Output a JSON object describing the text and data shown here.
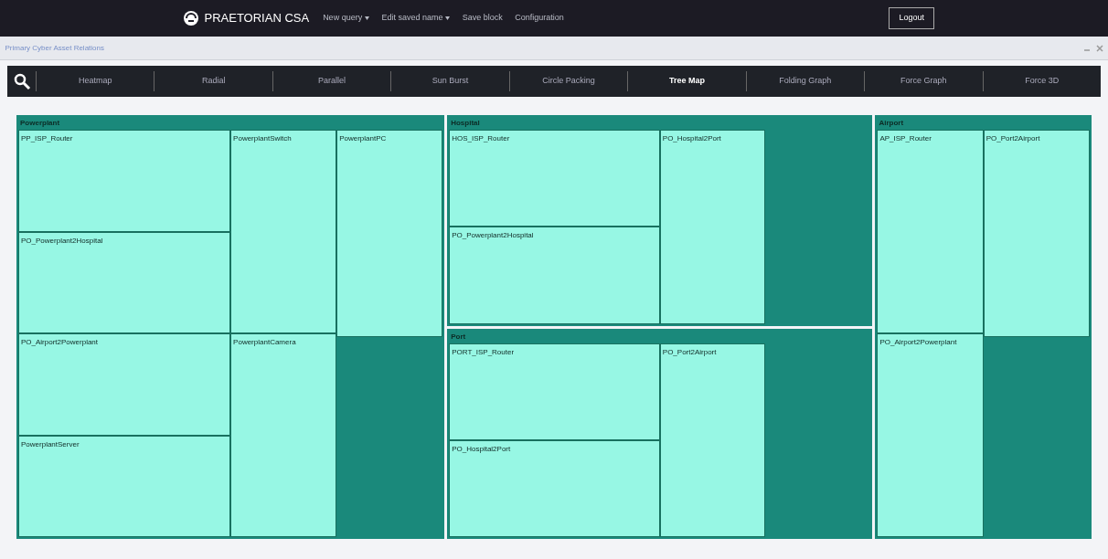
{
  "navbar": {
    "brand": "PRAETORIAN CSA",
    "menu": [
      {
        "label": "New query",
        "dropdown": true
      },
      {
        "label": "Edit saved name",
        "dropdown": true
      },
      {
        "label": "Save block",
        "dropdown": false
      },
      {
        "label": "Configuration",
        "dropdown": false
      }
    ],
    "logout": "Logout"
  },
  "panel": {
    "title": "Primary Cyber Asset Relations"
  },
  "tabs": [
    {
      "label": "Heatmap",
      "selected": false
    },
    {
      "label": "Radial",
      "selected": false
    },
    {
      "label": "Parallel",
      "selected": false
    },
    {
      "label": "Sun Burst",
      "selected": false
    },
    {
      "label": "Circle Packing",
      "selected": false
    },
    {
      "label": "Tree Map",
      "selected": true
    },
    {
      "label": "Folding Graph",
      "selected": false
    },
    {
      "label": "Force Graph",
      "selected": false
    },
    {
      "label": "Force 3D",
      "selected": false
    }
  ],
  "treemap": {
    "groups": [
      {
        "label": "Powerplant",
        "columns": [
          [
            "PP_ISP_Router",
            "PO_Powerplant2Hospital",
            "PO_Airport2Powerplant",
            "PowerplantServer"
          ],
          [
            "PowerplantSwitch",
            "PowerplantCamera"
          ],
          [
            "PowerplantPC"
          ]
        ]
      },
      {
        "label": "Hospital",
        "columns": [
          [
            "HOS_ISP_Router",
            "PO_Powerplant2Hospital"
          ],
          [
            "PO_Hospital2Port"
          ]
        ]
      },
      {
        "label": "Port",
        "columns": [
          [
            "PORT_ISP_Router",
            "PO_Hospital2Port"
          ],
          [
            "PO_Port2Airport"
          ]
        ]
      },
      {
        "label": "Airport",
        "columns": [
          [
            "AP_ISP_Router",
            "PO_Airport2Powerplant"
          ],
          [
            "PO_Port2Airport"
          ]
        ]
      }
    ]
  }
}
